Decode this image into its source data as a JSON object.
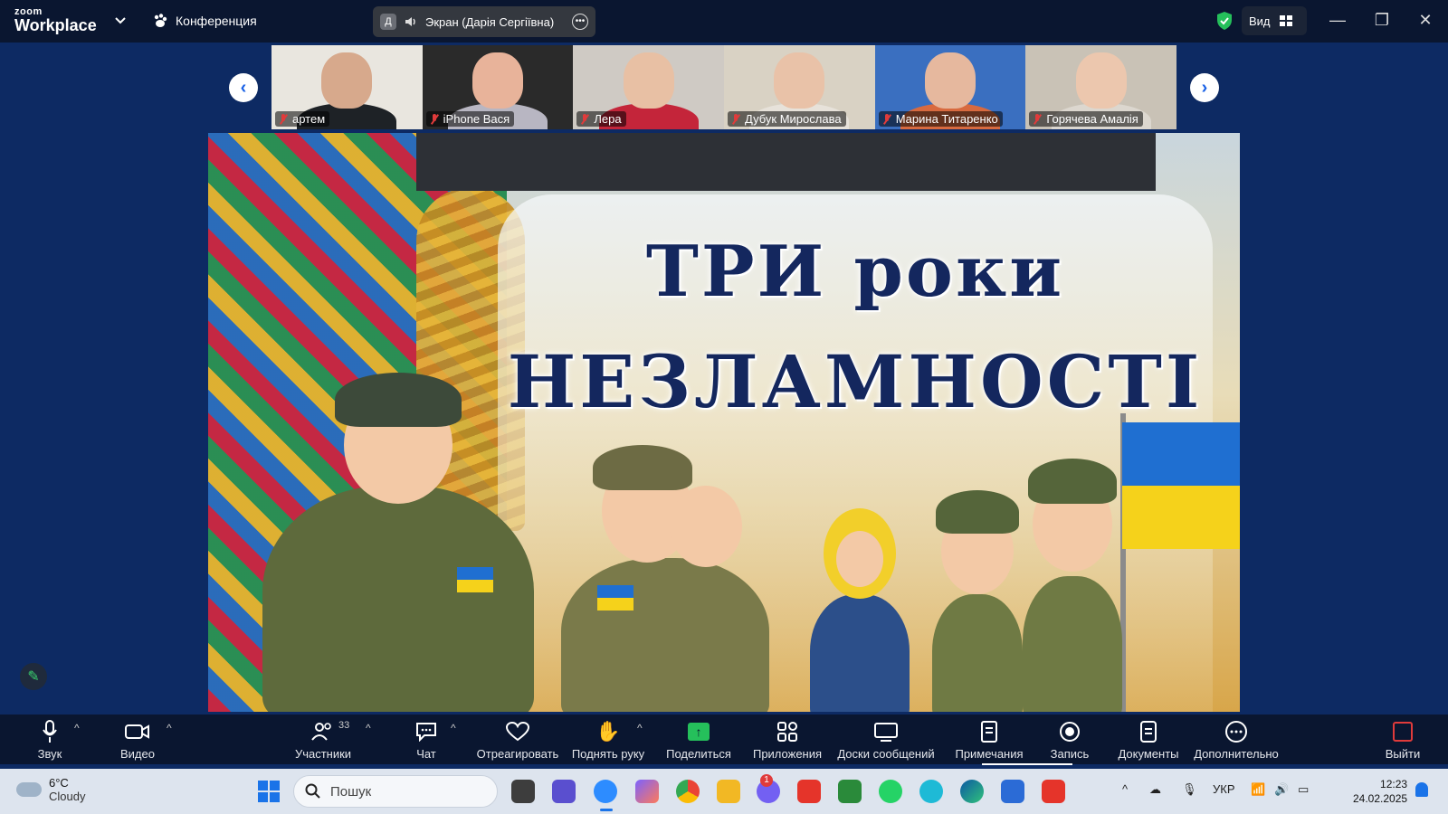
{
  "app": {
    "logo_top": "zoom",
    "logo_bottom": "Workplace",
    "meeting_label": "Конференция",
    "screen_share_avatar": "Д",
    "screen_share_label": "Экран (Дарія Сергіївна)",
    "view_label": "Вид"
  },
  "participants": [
    {
      "name": "артем",
      "skin": "#d7a98c",
      "bg": "#e9e6df",
      "shirt": "#1e2226"
    },
    {
      "name": "iPhone Вася",
      "skin": "#e8b39a",
      "bg": "#2a2a2a",
      "shirt": "#b8b6c2"
    },
    {
      "name": "Лера",
      "skin": "#e8c0a4",
      "bg": "#cfcac4",
      "shirt": "#c4253a"
    },
    {
      "name": "Дубук Мирослава",
      "skin": "#e9c2a8",
      "bg": "#d9d2c4",
      "shirt": "#e7e2da"
    },
    {
      "name": "Марина Титаренко",
      "skin": "#e6b89e",
      "bg": "#3a6fc0",
      "shirt": "#d86a3f"
    },
    {
      "name": "Горячева Амалія",
      "skin": "#ecc7ae",
      "bg": "#c9c2b6",
      "shirt": "#dcd7cf"
    }
  ],
  "slide": {
    "title_line1": "ТРИ роки",
    "title_line2": "НЕЗЛАМНОСТІ"
  },
  "toolbar": {
    "audio": "Звук",
    "video": "Видео",
    "participants": "Участники",
    "participants_count": "33",
    "chat": "Чат",
    "react": "Отреагировать",
    "raise_hand": "Поднять руку",
    "share": "Поделиться",
    "apps": "Приложения",
    "whiteboards": "Доски сообщений",
    "notes": "Примечания",
    "record": "Запись",
    "docs": "Документы",
    "more": "Дополнительно",
    "leave": "Выйти"
  },
  "taskbar": {
    "temperature": "6°C",
    "weather": "Cloudy",
    "search_placeholder": "Пошук",
    "language": "УКР",
    "time": "12:23",
    "date": "24.02.2025",
    "viber_badge": "1"
  },
  "colors": {
    "accent_blue": "#1961e6",
    "share_green": "#25c05b",
    "mute_red": "#e03b3b",
    "flag_blue": "#1f6fd1",
    "flag_yellow": "#f5d21b"
  }
}
